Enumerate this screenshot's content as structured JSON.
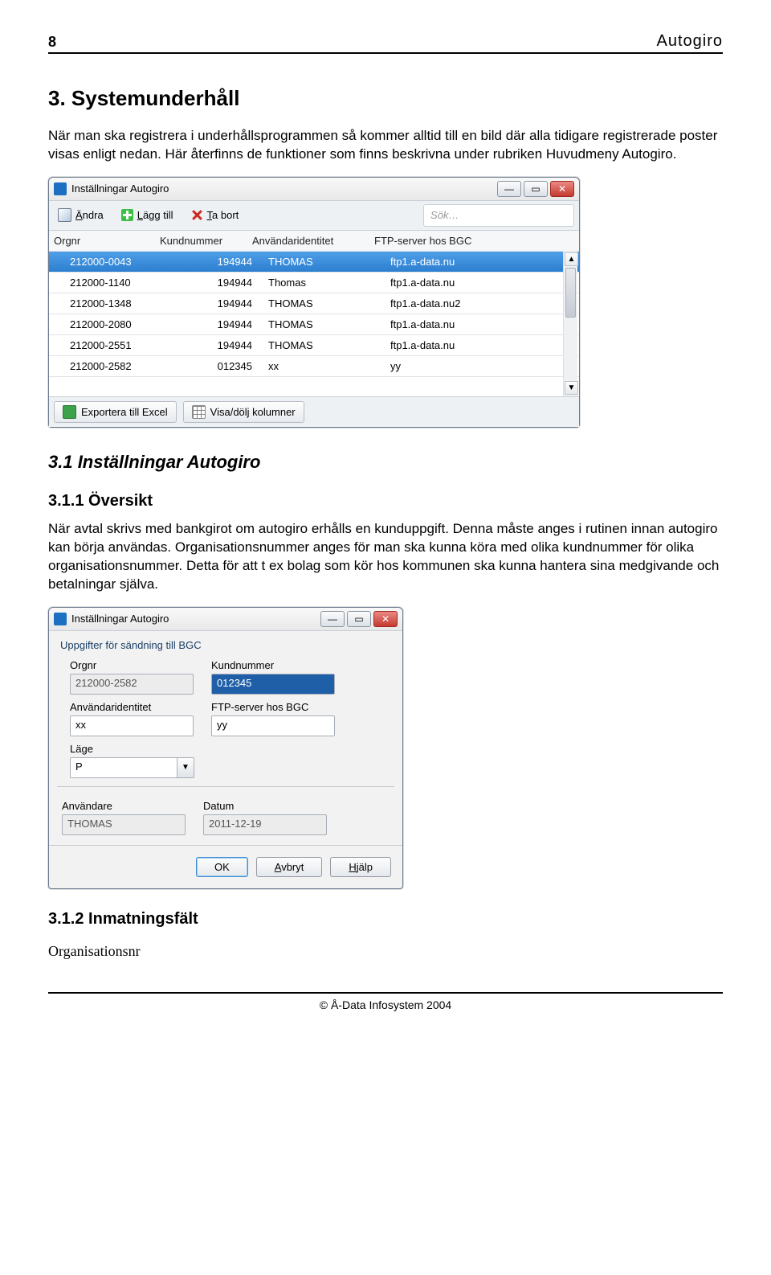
{
  "page": {
    "number": "8",
    "brand": "Autogiro",
    "footer": "© Å-Data Infosystem 2004"
  },
  "heading1": "3. Systemunderhåll",
  "para1": "När man ska registrera i underhållsprogrammen så kommer alltid till en bild där alla tidigare registrerade poster visas enligt nedan. Här återfinns de funktioner som finns beskrivna under rubriken Huvudmeny Autogiro.",
  "win1": {
    "title": "Inställningar Autogiro",
    "tb": {
      "edit": "Ändra",
      "add": "Lägg till",
      "del": "Ta bort",
      "search": "Sök…"
    },
    "cols": {
      "c1": "Orgnr",
      "c2": "Kundnummer",
      "c3": "Användaridentitet",
      "c4": "FTP-server hos BGC"
    },
    "rows": [
      {
        "c1": "212000-0043",
        "c2": "194944",
        "c3": "THOMAS",
        "c4": "ftp1.a-data.nu",
        "sel": true
      },
      {
        "c1": "212000-1140",
        "c2": "194944",
        "c3": "Thomas",
        "c4": "ftp1.a-data.nu"
      },
      {
        "c1": "212000-1348",
        "c2": "194944",
        "c3": "THOMAS",
        "c4": "ftp1.a-data.nu2"
      },
      {
        "c1": "212000-2080",
        "c2": "194944",
        "c3": "THOMAS",
        "c4": "ftp1.a-data.nu"
      },
      {
        "c1": "212000-2551",
        "c2": "194944",
        "c3": "THOMAS",
        "c4": "ftp1.a-data.nu"
      },
      {
        "c1": "212000-2582",
        "c2": "012345",
        "c3": "xx",
        "c4": "yy"
      }
    ],
    "bottom": {
      "excel": "Exportera till Excel",
      "cols": "Visa/dölj kolumner"
    }
  },
  "heading2": "3.1 Inställningar Autogiro",
  "heading3": "3.1.1 Översikt",
  "para2": "När avtal skrivs med bankgirot om autogiro erhålls en kunduppgift. Denna måste anges i rutinen innan autogiro kan börja användas. Organisationsnummer anges för man ska kunna köra med olika kundnummer för olika organisationsnummer. Detta för att t ex bolag som kör hos kommunen ska kunna hantera sina medgivande och betalningar själva.",
  "win2": {
    "title": "Inställningar Autogiro",
    "group1": "Uppgifter för sändning till BGC",
    "fields": {
      "orgnr_l": "Orgnr",
      "orgnr_v": "212000-2582",
      "kund_l": "Kundnummer",
      "kund_v": "012345",
      "anvid_l": "Användaridentitet",
      "anvid_v": "xx",
      "ftp_l": "FTP-server hos BGC",
      "ftp_v": "yy",
      "lage_l": "Läge",
      "lage_v": "P",
      "user_l": "Användare",
      "user_v": "THOMAS",
      "date_l": "Datum",
      "date_v": "2011-12-19"
    },
    "buttons": {
      "ok": "OK",
      "cancel": "Avbryt",
      "help": "Hjälp"
    }
  },
  "heading4": "3.1.2 Inmatningsfält",
  "subheading": "Organisationsnr"
}
